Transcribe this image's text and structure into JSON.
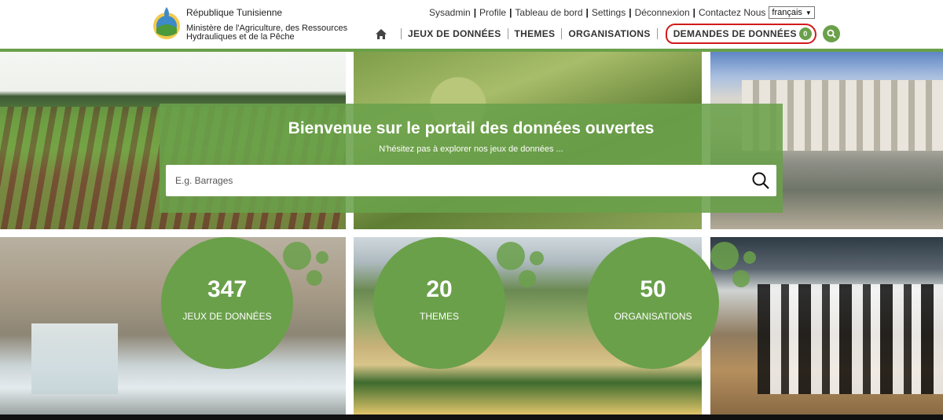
{
  "header": {
    "country": "République Tunisienne",
    "ministry_line1": "Ministère de l'Agriculture, des Ressources",
    "ministry_line2": "Hydrauliques et de la Pêche",
    "util_links": [
      "Sysadmin",
      "Profile",
      "Tableau de bord",
      "Settings",
      "Déconnexion",
      "Contactez Nous"
    ],
    "language": "français"
  },
  "nav": {
    "items": [
      "JEUX DE DONNÉES",
      "THEMES",
      "ORGANISATIONS"
    ],
    "demandes_label": "DEMANDES DE DONNÉES",
    "demandes_count": "0",
    "home_icon": "home-icon",
    "search_icon": "search-icon"
  },
  "hero": {
    "title": "Bienvenue sur le portail des données ouvertes",
    "subtitle": "N'hésitez pas à explorer nos jeux de données ...",
    "search_placeholder": "E.g. Barrages"
  },
  "stats": [
    {
      "value": "347",
      "label": "JEUX DE DONNÉES"
    },
    {
      "value": "20",
      "label": "THEMES"
    },
    {
      "value": "50",
      "label": "ORGANISATIONS"
    }
  ],
  "colors": {
    "accent_green": "#6aa04a",
    "highlight_red": "#d11a1a"
  }
}
